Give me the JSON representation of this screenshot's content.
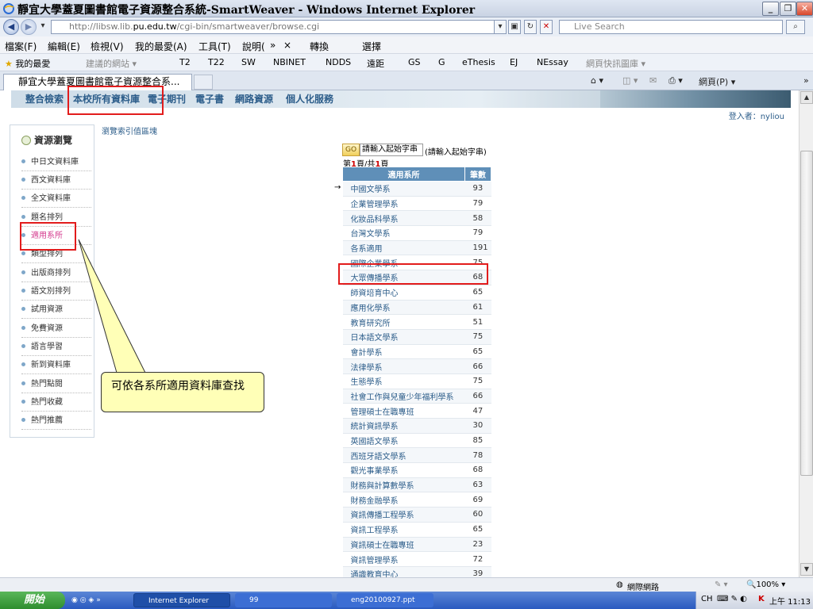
{
  "window": {
    "title": "靜宜大學蓋夏圖書館電子資源整合系統-SmartWeaver - Windows Internet Explorer"
  },
  "address": {
    "url_prefix": "http://libsw.lib.",
    "url_domain": "pu.edu.tw",
    "url_path": "/cgi-bin/smartweaver/browse.cgi",
    "search_placeholder": "Live Search"
  },
  "menu": [
    "檔案(F)",
    "編輯(E)",
    "檢視(V)",
    "我的最愛(A)",
    "工具(T)",
    "說明(",
    "»",
    "×",
    "轉換",
    "選擇"
  ],
  "favorites": {
    "label": "我的最愛",
    "items": [
      "建議的網站 ▾",
      "T2",
      "T22",
      "SW",
      "NBINET",
      "NDDS",
      "遠距",
      "GS",
      "G",
      "eThesis",
      "EJ",
      "NEssay",
      "網頁快訊圖庫 ▾"
    ]
  },
  "tab": {
    "title": "靜宜大學蓋夏圖書館電子資源整合系...",
    "page_menu": "網頁(P) ▾"
  },
  "site_nav": [
    "整合檢索",
    "本校所有資料庫",
    "電子期刊",
    "電子書",
    "網路資源",
    "個人化服務"
  ],
  "login_text": "登入者：nyliou",
  "sidebar": {
    "heading": "資源瀏覽",
    "items": [
      "中日文資料庫",
      "西文資料庫",
      "全文資料庫",
      "題名排列",
      "適用系所",
      "類型排列",
      "出版商排列",
      "語文別排列",
      "試用資源",
      "免費資源",
      "語言學習",
      "新到資料庫",
      "熱門點閱",
      "熱門收藏",
      "熱門推薦"
    ]
  },
  "browse_label": "瀏覽索引值區塊",
  "search_start": {
    "go": "GO",
    "input_value": "請輸入起始字串",
    "hint": "(請輸入起始字串)"
  },
  "page_info": {
    "prefix": "第",
    "current": "1",
    "mid": "頁/共",
    "total": "1",
    "suffix": "頁"
  },
  "table": {
    "headers": [
      "適用系所",
      "筆數"
    ],
    "rows": [
      {
        "name": "中國文學系",
        "count": "93"
      },
      {
        "name": "企業管理學系",
        "count": "79"
      },
      {
        "name": "化妝品科學系",
        "count": "58"
      },
      {
        "name": "台灣文學系",
        "count": "79"
      },
      {
        "name": "各系適用",
        "count": "191"
      },
      {
        "name": "國際企業學系",
        "count": "75"
      },
      {
        "name": "大眾傳播學系",
        "count": "68"
      },
      {
        "name": "師資培育中心",
        "count": "65"
      },
      {
        "name": "應用化學系",
        "count": "61"
      },
      {
        "name": "教育研究所",
        "count": "51"
      },
      {
        "name": "日本語文學系",
        "count": "75"
      },
      {
        "name": "會計學系",
        "count": "65"
      },
      {
        "name": "法律學系",
        "count": "66"
      },
      {
        "name": "生態學系",
        "count": "75"
      },
      {
        "name": "社會工作與兒童少年福利學系",
        "count": "66"
      },
      {
        "name": "管理碩士在職專班",
        "count": "47"
      },
      {
        "name": "統計資訊學系",
        "count": "30"
      },
      {
        "name": "英國語文學系",
        "count": "85"
      },
      {
        "name": "西班牙語文學系",
        "count": "78"
      },
      {
        "name": "觀光事業學系",
        "count": "68"
      },
      {
        "name": "財務與計算數學系",
        "count": "63"
      },
      {
        "name": "財務金融學系",
        "count": "69"
      },
      {
        "name": "資訊傳播工程學系",
        "count": "60"
      },
      {
        "name": "資訊工程學系",
        "count": "65"
      },
      {
        "name": "資訊碩士在職專班",
        "count": "23"
      },
      {
        "name": "資訊管理學系",
        "count": "72"
      },
      {
        "name": "通識教育中心",
        "count": "39"
      }
    ]
  },
  "callout_text": "可依各系所適用資料庫查找",
  "status": {
    "zone": "網際網路",
    "zoom": "100%"
  },
  "taskbar": {
    "start": "開始",
    "items": [
      "Internet Explorer",
      "99",
      "eng20100927.ppt"
    ],
    "tray_lang": "CH",
    "clock": "上午 11:13"
  },
  "colors": {
    "highlight": "#e21c1c",
    "table_header": "#5f8fb8",
    "link": "#2c5d8a",
    "callout_bg": "#ffffb7"
  }
}
